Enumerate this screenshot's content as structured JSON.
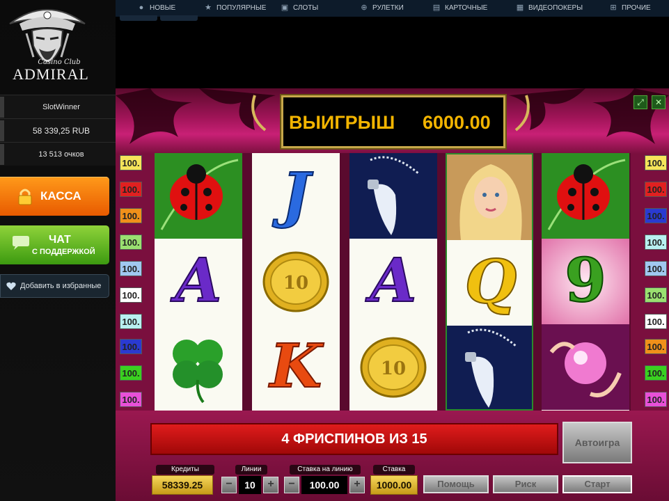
{
  "brand": {
    "small": "Casino Club",
    "name": "ADMIRAL"
  },
  "account": {
    "username": "SlotWinner",
    "balance": "58 339,25 RUB",
    "points": "13 513 очков"
  },
  "sidebar_buttons": {
    "cashier": "КАССА",
    "chat_line1": "ЧАТ",
    "chat_line2": "С ПОДДЕРЖКОЙ",
    "favorite": "Добавить в избранные"
  },
  "nav": [
    {
      "label": "НОВЫЕ",
      "icon": "new-icon"
    },
    {
      "label": "ПОПУЛЯРНЫЕ",
      "icon": "star-icon"
    },
    {
      "label": "СЛОТЫ",
      "icon": "slots-icon"
    },
    {
      "label": "РУЛЕТКИ",
      "icon": "roulette-icon"
    },
    {
      "label": "КАРТОЧНЫЕ",
      "icon": "cards-icon"
    },
    {
      "label": "ВИДЕОПОКЕРЫ",
      "icon": "videopoker-icon"
    },
    {
      "label": "ПРОЧИЕ",
      "icon": "other-icon"
    }
  ],
  "game": {
    "win_label": "ВЫИГРЫШ",
    "win_value": "6000.00",
    "status": "4 ФРИСПИНОВ ИЗ 15",
    "autoplay": "Автоигра",
    "help": "Помощь",
    "risk": "Риск",
    "start": "Старт",
    "credits_label": "Кредиты",
    "credits": "58339.25",
    "lines_label": "Линии",
    "lines": "10",
    "bet_per_line_label": "Ставка на линию",
    "bet_per_line": "100.00",
    "bet_label": "Ставка",
    "bet": "1000.00",
    "line_badges_left": [
      "100.",
      "100.",
      "100.",
      "100.",
      "100.",
      "100.",
      "100.",
      "100.",
      "100.",
      "100."
    ],
    "line_badges_right": [
      "100.",
      "100.",
      "100.",
      "100.",
      "100.",
      "100.",
      "100.",
      "100.",
      "100.",
      "100."
    ],
    "reels": [
      [
        "ladybug",
        "A",
        "clover"
      ],
      [
        "J",
        "gold-coin",
        "K"
      ],
      [
        "feather-pendant",
        "A",
        "gold-coin"
      ],
      [
        "blonde-woman",
        "Q",
        "feather-pendant"
      ],
      [
        "ladybug",
        "9",
        "crystal-ball"
      ]
    ]
  },
  "colors": {
    "accent_orange": "#ff8a00",
    "accent_green": "#5cb82a",
    "win_gold": "#f2b400",
    "status_red": "#d81a1a"
  }
}
